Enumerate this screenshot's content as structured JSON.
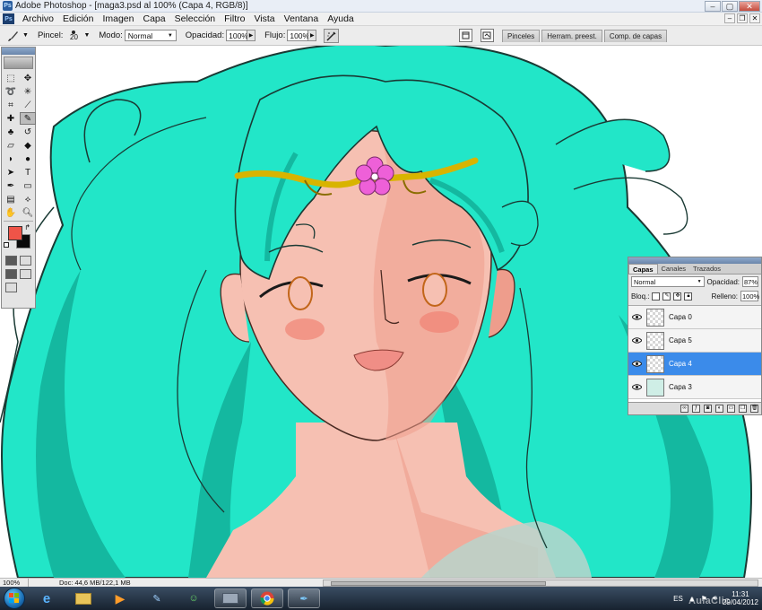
{
  "window": {
    "title": "Adobe Photoshop - [maga3.psd al 100% (Capa 4, RGB/8)]",
    "app_icon_text": "Ps"
  },
  "menu": [
    "Archivo",
    "Edición",
    "Imagen",
    "Capa",
    "Selección",
    "Filtro",
    "Vista",
    "Ventana",
    "Ayuda"
  ],
  "options_bar": {
    "pincel_label": "Pincel:",
    "brush_size": "20",
    "modo_label": "Modo:",
    "modo_value": "Normal",
    "opacidad_label": "Opacidad:",
    "opacidad_value": "100%",
    "flujo_label": "Flujo:",
    "flujo_value": "100%"
  },
  "palette_well_tabs": [
    "Pinceles",
    "Herram. preest.",
    "Comp. de capas"
  ],
  "toolbox": {
    "foreground_color": "#ef5448",
    "background_color": "#0a0a0a"
  },
  "layers_panel": {
    "tabs": [
      "Capas",
      "Canales",
      "Trazados"
    ],
    "blend_mode": "Normal",
    "opacity_label": "Opacidad:",
    "opacity_value": "87%",
    "lock_label": "Bloq.:",
    "fill_label": "Relleno:",
    "fill_value": "100%",
    "layers": [
      {
        "name": "Capa 0",
        "visible": true,
        "selected": false
      },
      {
        "name": "Capa 5",
        "visible": true,
        "selected": false
      },
      {
        "name": "Capa 4",
        "visible": true,
        "selected": true
      },
      {
        "name": "Capa 3",
        "visible": true,
        "selected": false
      }
    ]
  },
  "status_bar": {
    "zoom": "100%",
    "doc_info": "Doc: 44,6 MB/122,1 MB"
  },
  "taskbar": {
    "language": "ES",
    "time": "11:31",
    "date": "29/04/2012",
    "watermark": "AulaClic"
  },
  "colors": {
    "hair": "#22e6c8",
    "hair_shadow": "#14b8a0",
    "skin": "#f6c0b2",
    "skin_shadow": "#ee9d8c",
    "blush": "#f08070",
    "circlet": "#d8b400",
    "flower": "#ee60d8",
    "selection_blue": "#3b8bea"
  }
}
